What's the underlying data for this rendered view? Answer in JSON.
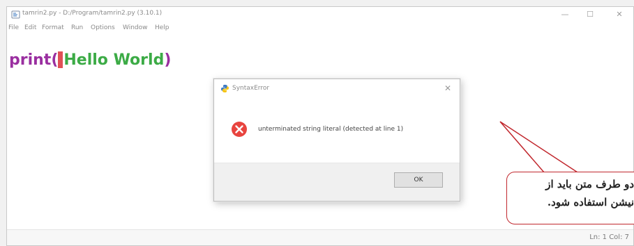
{
  "window": {
    "title": "tamrin2.py - D:/Program/tamrin2.py (3.10.1)",
    "minimize": "—",
    "maximize": "☐",
    "close": "✕"
  },
  "menu": [
    "File",
    "Edit",
    "Format",
    "Run",
    "Options",
    "Window",
    "Help"
  ],
  "editor": {
    "code_keyword": "print",
    "code_open_paren": "(",
    "code_string": "Hello World",
    "code_close_paren": ")"
  },
  "status": {
    "text": "Ln: 1   Col: 7"
  },
  "dialog": {
    "title": "SyntaxError",
    "close": "✕",
    "message": "unterminated string literal (detected at line 1)",
    "ok_label": "OK"
  },
  "callout": {
    "line1": "دو طرف متن باید از",
    "line2": "نیشن استفاده شود."
  },
  "colors": {
    "keyword": "#9a2fa0",
    "string": "#3cab46",
    "cursor": "#e05056",
    "callout_border": "#c1272d",
    "error_icon": "#e8443f"
  }
}
